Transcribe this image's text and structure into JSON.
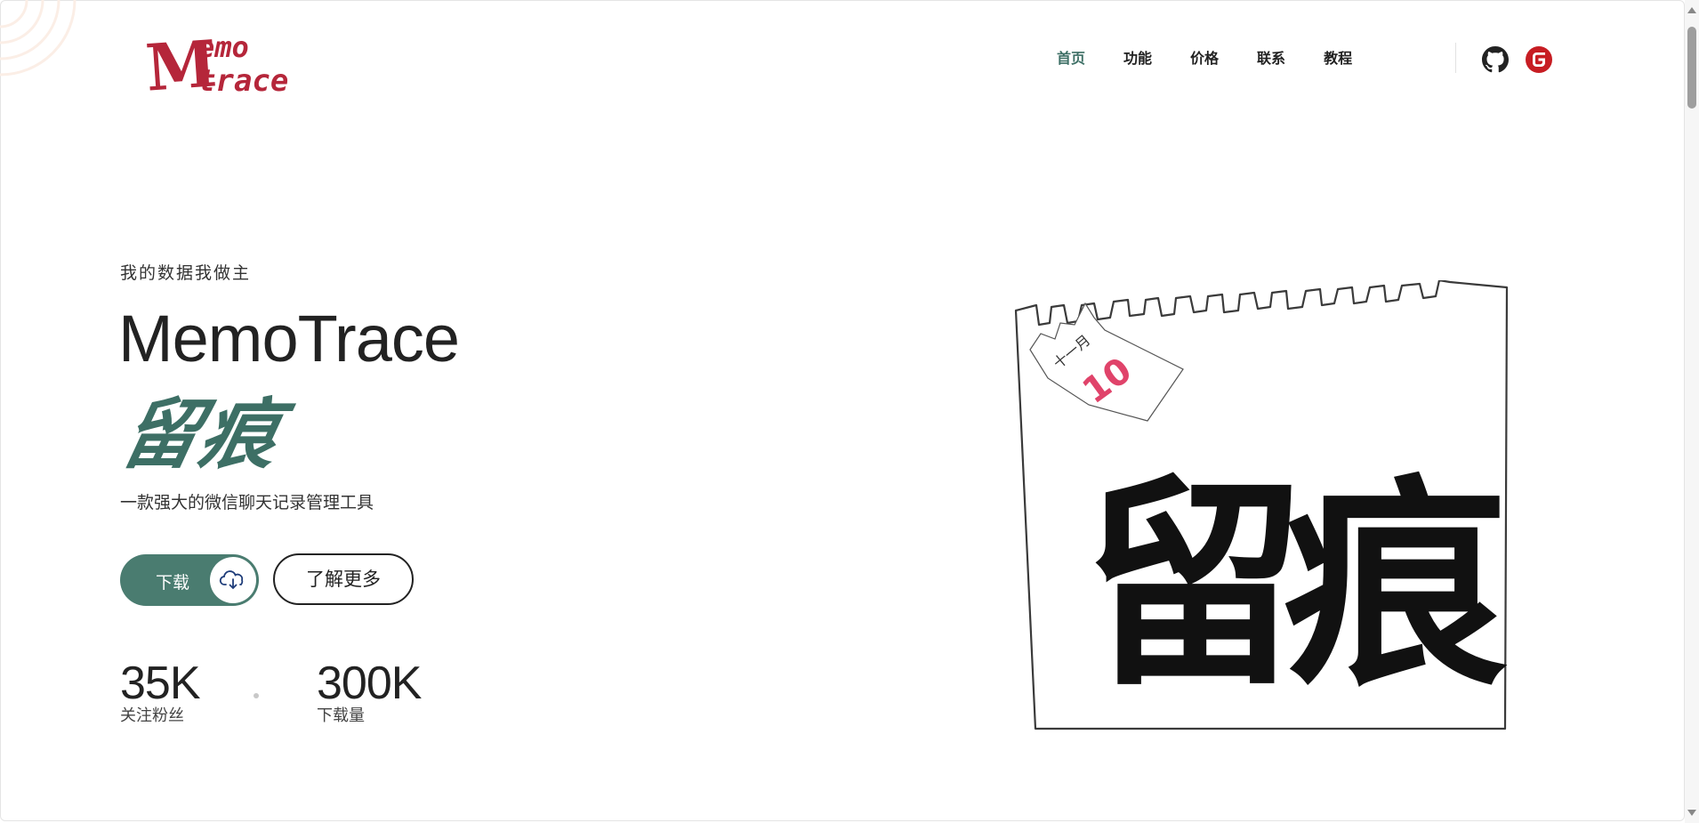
{
  "header": {
    "logo_top": "emo",
    "logo_bottom": "trace",
    "logo_initial": "M",
    "nav": [
      "首页",
      "功能",
      "价格",
      "联系",
      "教程"
    ],
    "active_nav": "首页"
  },
  "hero": {
    "tagline": "我的数据我做主",
    "title": "MemoTrace",
    "title_cn": "留痕",
    "description": "一款强大的微信聊天记录管理工具",
    "download_label": "下载",
    "learn_more_label": "了解更多",
    "stats": [
      {
        "value": "35K",
        "label": "关注粉丝"
      },
      {
        "value": "300K",
        "label": "下载量"
      }
    ]
  },
  "illustration": {
    "calendar_month": "十一月",
    "calendar_day": "10",
    "big_text": "留痕"
  },
  "colors": {
    "accent": "#3d6f65",
    "logo": "#b5263a",
    "gitee": "#c71d23",
    "calendar_number": "#e0436a"
  },
  "icons": {
    "github": "github-icon",
    "gitee": "gitee-icon",
    "download": "cloud-download-icon"
  }
}
